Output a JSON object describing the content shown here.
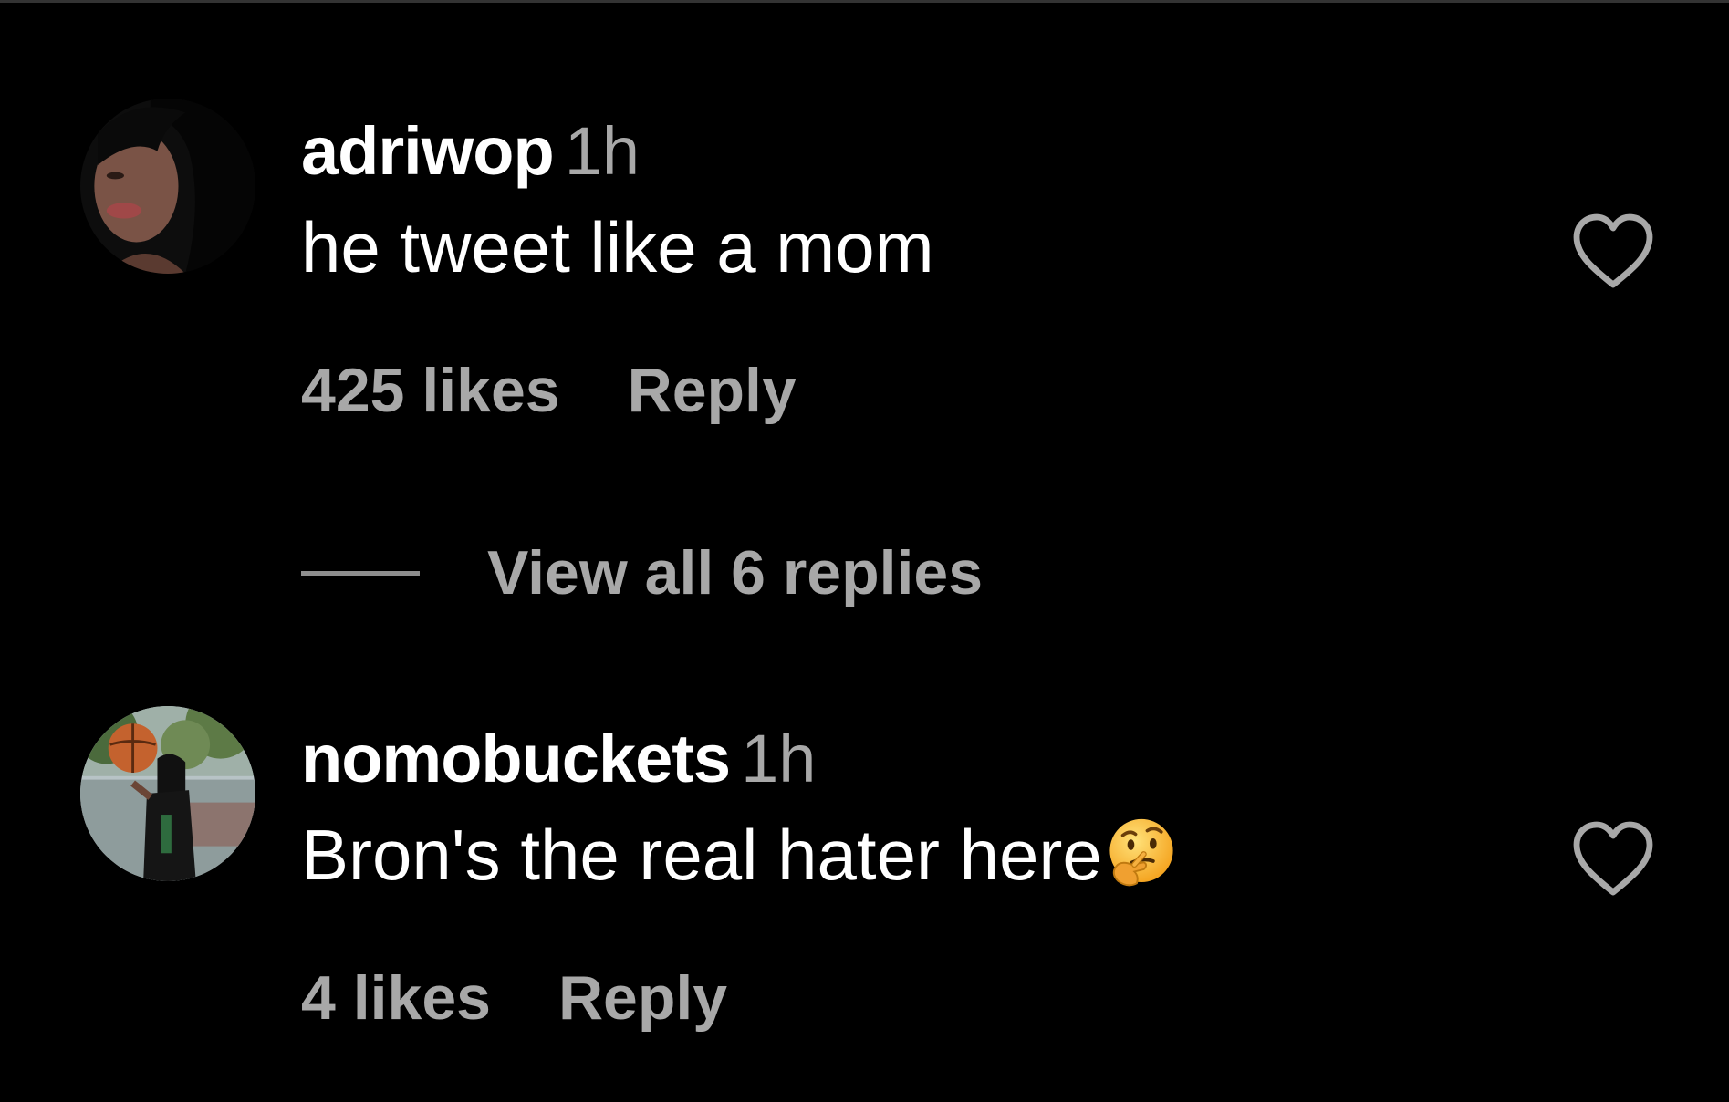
{
  "comments": [
    {
      "username": "adriwop",
      "time": "1h",
      "text": "he tweet like a mom",
      "likes": "425 likes",
      "reply_label": "Reply",
      "avatar_icon": "user-avatar-photo",
      "like_icon": "heart-outline-icon"
    },
    {
      "username": "nomobuckets",
      "time": "1h",
      "text": "Bron's the real hater here",
      "emoji": "thinking-face-emoji",
      "likes": "4 likes",
      "reply_label": "Reply",
      "avatar_icon": "user-avatar-photo",
      "like_icon": "heart-outline-icon"
    }
  ],
  "view_replies": {
    "label": "View all 6 replies"
  },
  "colors": {
    "background": "#000000",
    "primary_text": "#ffffff",
    "secondary_text": "#a8a8a8",
    "icon_stroke": "#a8a8a8"
  }
}
